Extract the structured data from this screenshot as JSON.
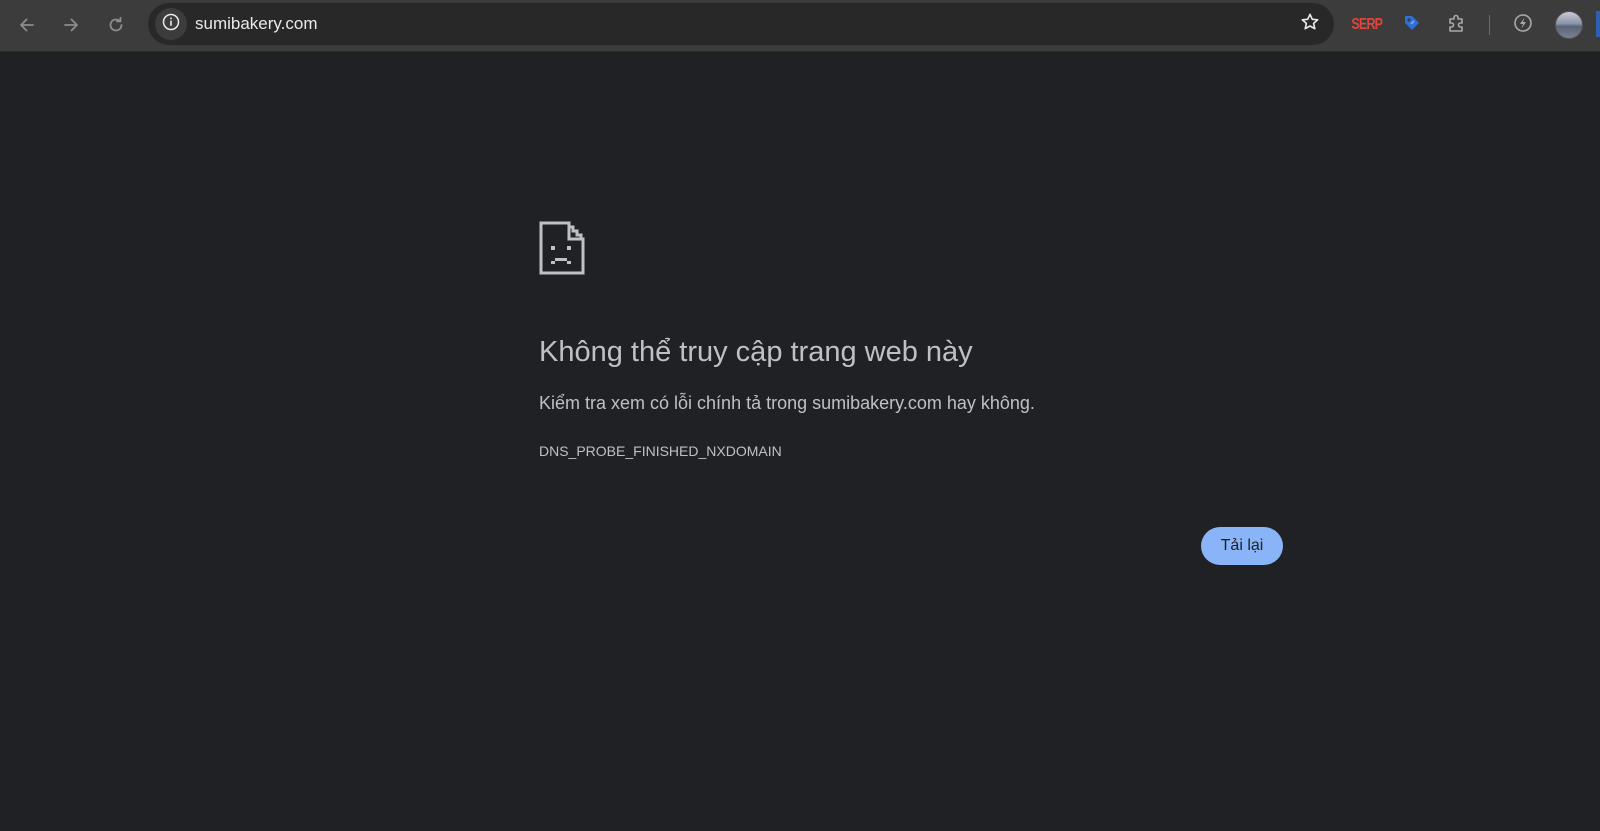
{
  "browser": {
    "url": "sumibakery.com",
    "icons": {
      "back": "arrow-left-icon",
      "forward": "arrow-right-icon",
      "reload": "reload-icon",
      "site_info": "info-icon",
      "bookmark": "star-icon",
      "extensions": "puzzle-icon",
      "tag": "tag-icon",
      "performance": "lightning-icon"
    },
    "extension_serp_label": "SERP"
  },
  "error_page": {
    "icon": "sad-document-icon",
    "title": "Không thể truy cập trang web này",
    "description": "Kiểm tra xem có lỗi chính tả trong sumibakery.com hay không.",
    "error_code": "DNS_PROBE_FINISHED_NXDOMAIN",
    "reload_label": "Tải lại"
  },
  "colors": {
    "page_background": "#202124",
    "toolbar_background": "#3c3c3c",
    "text": "#bdc1c6",
    "button_accent": "#8ab4f8",
    "serp_red": "#e0463c",
    "tag_blue": "#2f6fd8"
  }
}
